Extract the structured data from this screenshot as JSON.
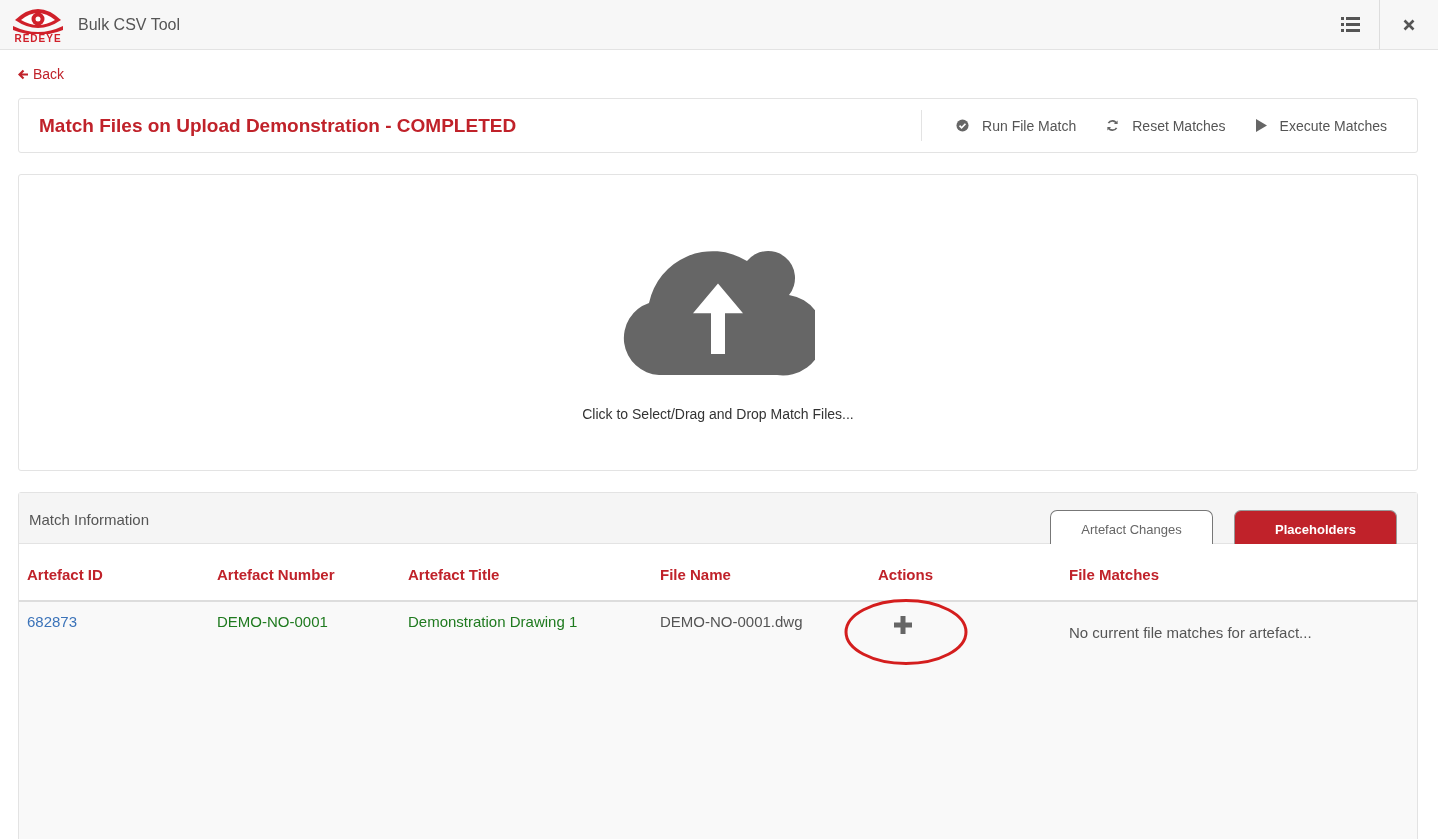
{
  "header": {
    "logo_text": "REDEYE",
    "title": "Bulk CSV Tool"
  },
  "back": {
    "label": "Back"
  },
  "job": {
    "title": "Match Files on Upload Demonstration - COMPLETED",
    "actions": [
      {
        "kind": "check",
        "label": "Run File Match"
      },
      {
        "kind": "refresh",
        "label": "Reset Matches"
      },
      {
        "kind": "play",
        "label": "Execute Matches"
      }
    ]
  },
  "upload": {
    "prompt": "Click to Select/Drag and Drop Match Files..."
  },
  "match_panel": {
    "title": "Match Information",
    "tabs": [
      {
        "label": "Artefact Changes",
        "selected": false
      },
      {
        "label": "Placeholders",
        "selected": true
      }
    ],
    "columns": [
      "Artefact ID",
      "Artefact Number",
      "Artefact Title",
      "File Name",
      "Actions",
      "File Matches"
    ],
    "rows": [
      {
        "artefact_id": "682873",
        "artefact_number": "DEMO-NO-0001",
        "artefact_title": "Demonstration Drawing 1",
        "file_name": "DEMO-NO-0001.dwg",
        "action_highlighted": true,
        "file_matches": "No current file matches for artefact..."
      }
    ]
  }
}
